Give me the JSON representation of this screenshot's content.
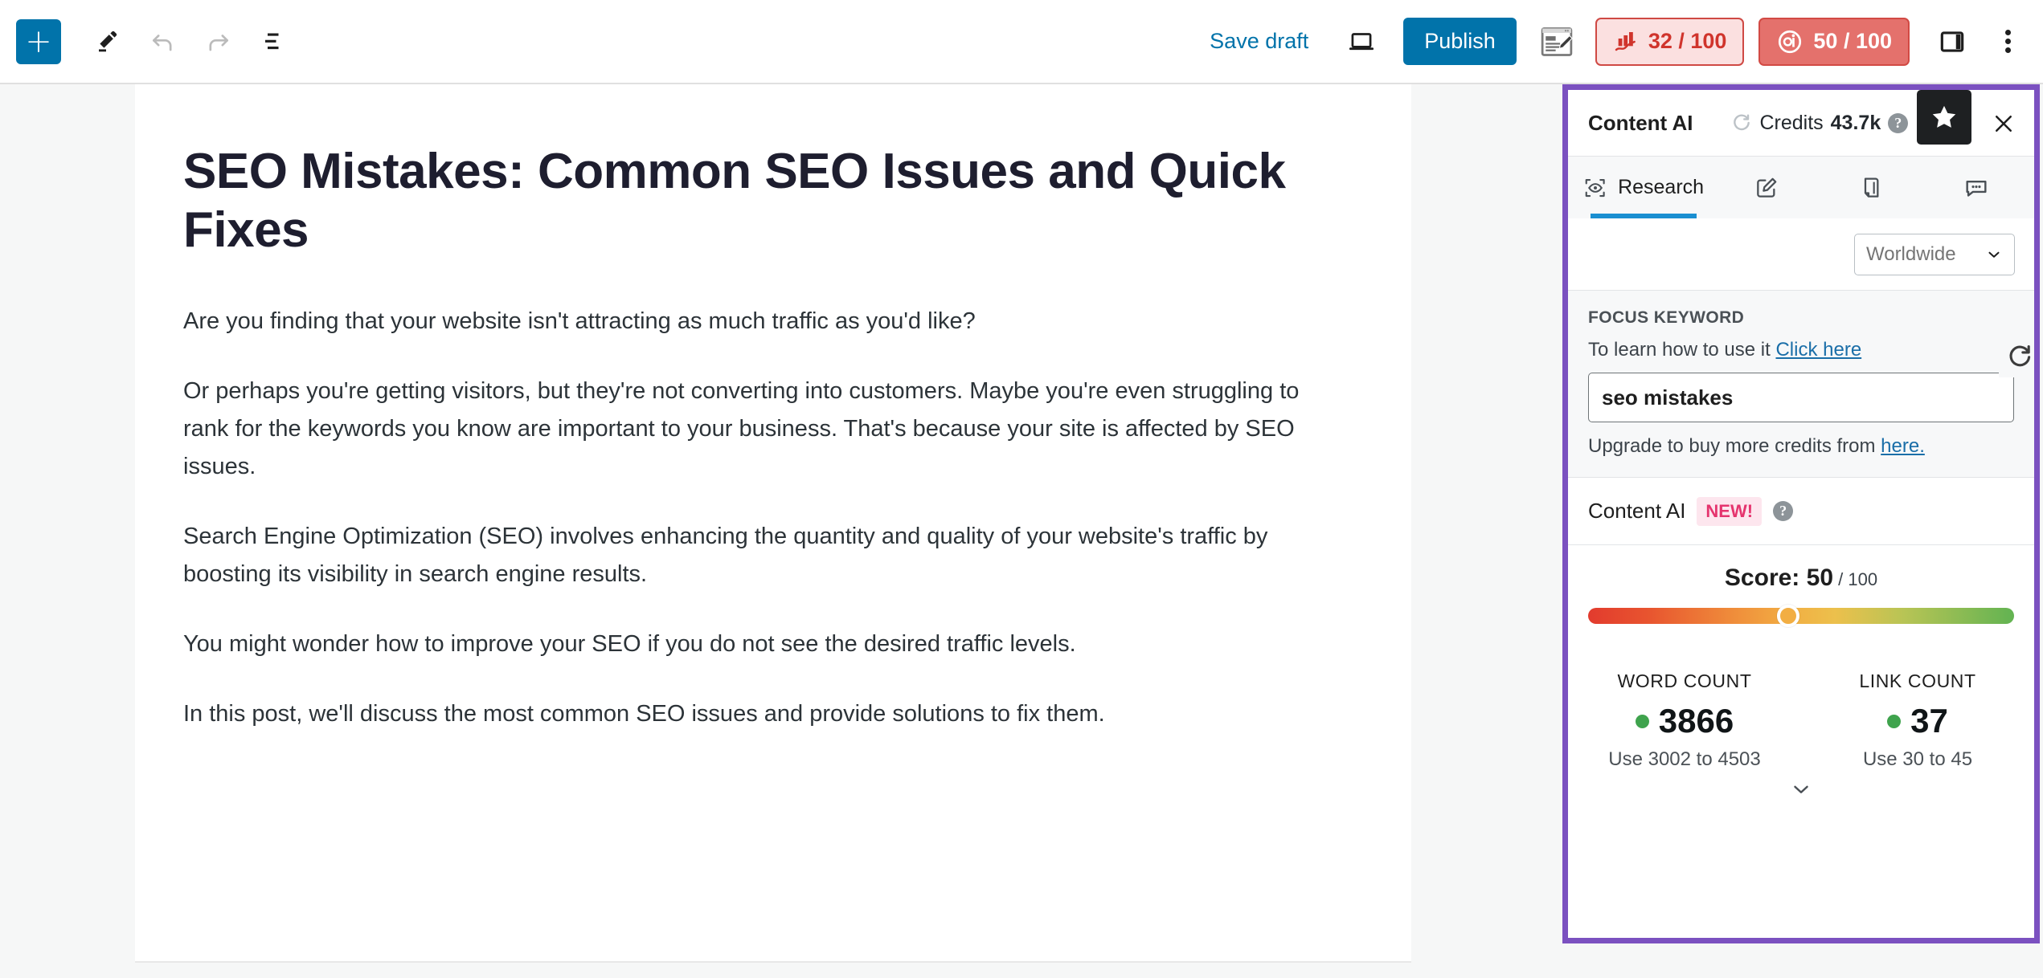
{
  "toolbar": {
    "add_block_icon": "plus-icon",
    "edit_tool_icon": "pencil-icon",
    "undo_icon": "undo-arrow-icon",
    "redo_icon": "redo-arrow-icon",
    "list_view_icon": "document-outline-icon",
    "save_draft_label": "Save draft",
    "preview_icon": "laptop-preview-icon",
    "publish_label": "Publish",
    "rankmath_edit_icon": "page-edit-icon",
    "seo_score": "32 / 100",
    "seo_score_icon": "bar-chart-arrow-icon",
    "contentai_score": "50 / 100",
    "contentai_score_icon": "ai-circle-icon",
    "sidebar_toggle_icon": "sidebar-panel-icon",
    "more_menu_icon": "kebab-menu-icon"
  },
  "post": {
    "title": "SEO Mistakes: Common SEO Issues and Quick Fixes",
    "paragraphs": [
      "Are you finding that your website isn't attracting as much traffic as you'd like?",
      "Or perhaps you're getting visitors, but they're not converting into customers. Maybe you're even struggling to rank for the keywords you know are important to your business. That's because your site is affected by SEO issues.",
      "Search Engine Optimization (SEO) involves enhancing the quantity and quality of your website's traffic by boosting its visibility in search engine results.",
      "You might wonder how to improve your SEO if you do not see the desired traffic levels.",
      "In this post, we'll discuss the most common SEO issues and provide solutions to fix them."
    ]
  },
  "panel": {
    "title": "Content AI",
    "credits_label": "Credits",
    "credits_value": "43.7k",
    "credits_refresh_icon": "refresh-icon",
    "credits_help_icon": "help-icon",
    "star_icon": "star-icon",
    "close_icon": "close-icon",
    "border_color": "#7b51c0",
    "tabs": [
      {
        "label": "Research",
        "icon": "research-eye-icon",
        "active": true
      },
      {
        "label": "",
        "icon": "write-pencil-square-icon",
        "active": false
      },
      {
        "label": "",
        "icon": "page-document-icon",
        "active": false
      },
      {
        "label": "",
        "icon": "chat-bubble-icon",
        "active": false
      }
    ],
    "region": {
      "selected": "Worldwide",
      "chevron_icon": "chevron-down-icon"
    },
    "focus_keyword": {
      "section_label": "FOCUS KEYWORD",
      "help_text": "To learn how to use it ",
      "help_link": "Click here",
      "input_value": "seo mistakes",
      "refresh_icon": "refresh-circular-icon",
      "upgrade_text": "Upgrade to buy more credits from ",
      "upgrade_link": "here."
    },
    "contentai_section": {
      "title": "Content AI",
      "badge": "NEW!",
      "help_icon": "help-icon",
      "score_prefix": "Score: ",
      "score_value": "50",
      "score_denominator": " / 100",
      "score_percent": 47,
      "metrics": [
        {
          "label": "WORD COUNT",
          "value": "3866",
          "hint": "Use 3002 to 4503",
          "dot_color": "#3fa34d"
        },
        {
          "label": "LINK COUNT",
          "value": "37",
          "hint": "Use 30 to 45",
          "dot_color": "#3fa34d"
        }
      ],
      "expand_icon": "chevron-down-icon"
    }
  },
  "colors": {
    "accent_blue": "#0173aa",
    "panel_purple": "#7b51c0",
    "seo_red": "#d0342c",
    "contentai_red_bg": "#e4716c",
    "new_badge_pink": "#e5346e",
    "good_green": "#3fa34d"
  }
}
